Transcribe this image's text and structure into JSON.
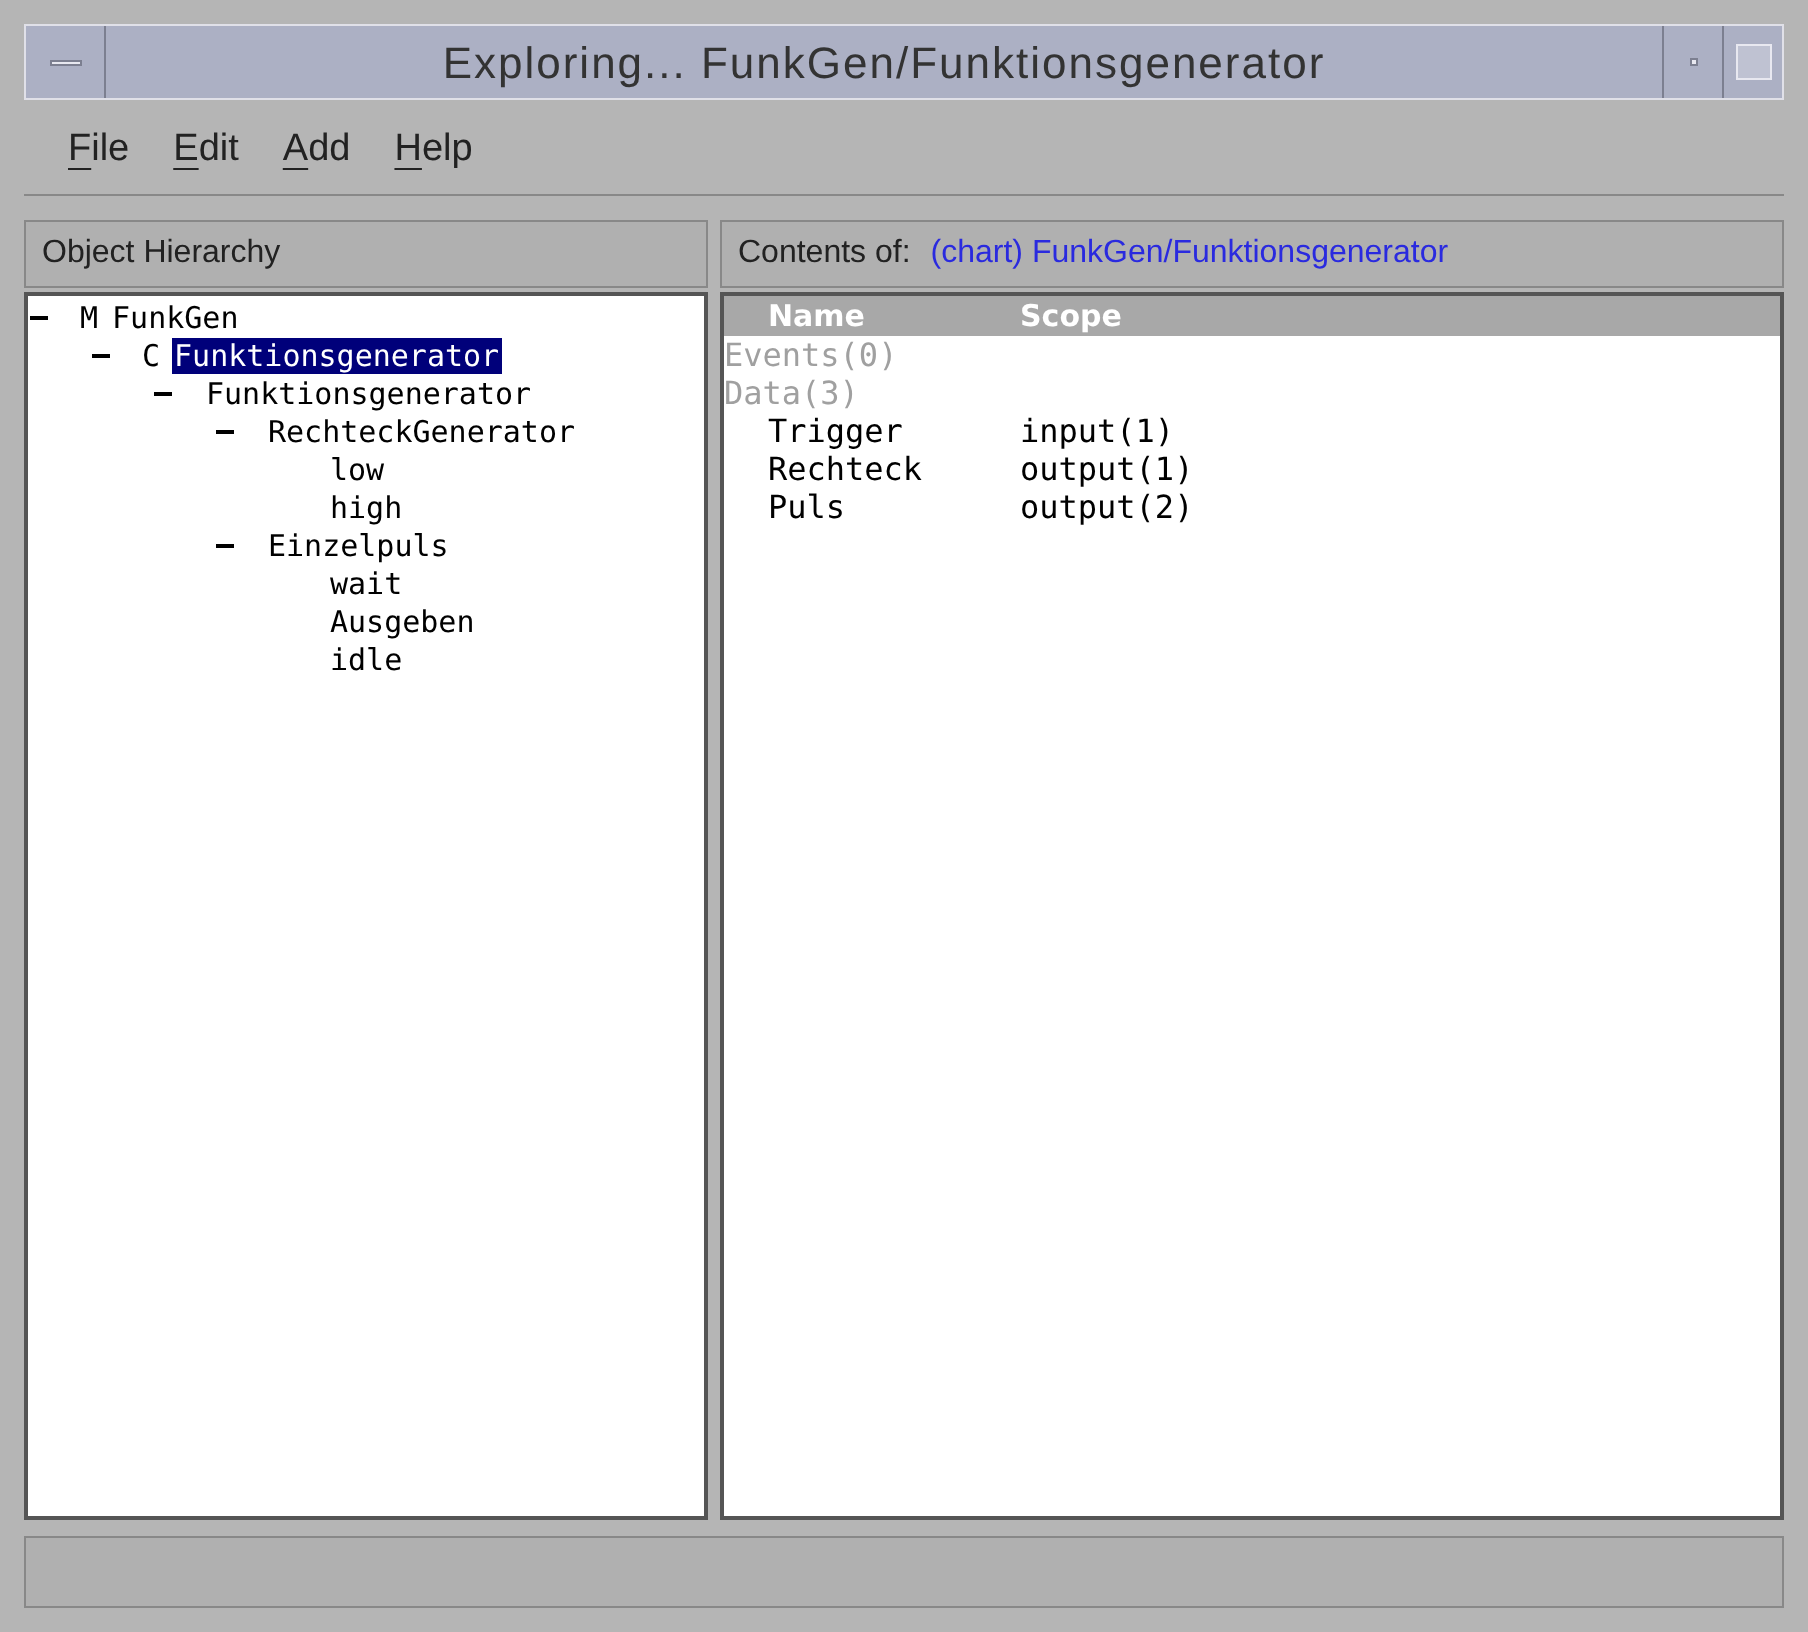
{
  "window": {
    "title": "Exploring... FunkGen/Funktionsgenerator"
  },
  "menu": [
    {
      "label": "File"
    },
    {
      "label": "Edit"
    },
    {
      "label": "Add"
    },
    {
      "label": "Help"
    }
  ],
  "hierarchy": {
    "title": "Object Hierarchy",
    "tree": [
      {
        "type_mark": "M",
        "label": "FunkGen",
        "expanded": true,
        "selected": false,
        "children": [
          {
            "type_mark": "C",
            "label": "Funktionsgenerator",
            "expanded": true,
            "selected": true,
            "children": [
              {
                "label": "Funktionsgenerator",
                "expanded": true,
                "selected": false,
                "children": [
                  {
                    "label": "RechteckGenerator",
                    "expanded": true,
                    "selected": false,
                    "children": [
                      {
                        "label": "low",
                        "selected": false
                      },
                      {
                        "label": "high",
                        "selected": false
                      }
                    ]
                  },
                  {
                    "label": "Einzelpuls",
                    "expanded": true,
                    "selected": false,
                    "children": [
                      {
                        "label": "wait",
                        "selected": false
                      },
                      {
                        "label": "Ausgeben",
                        "selected": false
                      },
                      {
                        "label": "idle",
                        "selected": false
                      }
                    ]
                  }
                ]
              }
            ]
          }
        ]
      }
    ]
  },
  "contents": {
    "label": "Contents of:",
    "path": "(chart) FunkGen/Funktionsgenerator",
    "columns": [
      "Name",
      "Scope"
    ],
    "rows": [
      {
        "kind": "group",
        "name": "Events(0)"
      },
      {
        "kind": "group",
        "name": "Data(3)"
      },
      {
        "kind": "item",
        "name": "Trigger",
        "scope": "input(1)"
      },
      {
        "kind": "item",
        "name": "Rechteck",
        "scope": "output(1)"
      },
      {
        "kind": "item",
        "name": "Puls",
        "scope": "output(2)"
      }
    ]
  }
}
